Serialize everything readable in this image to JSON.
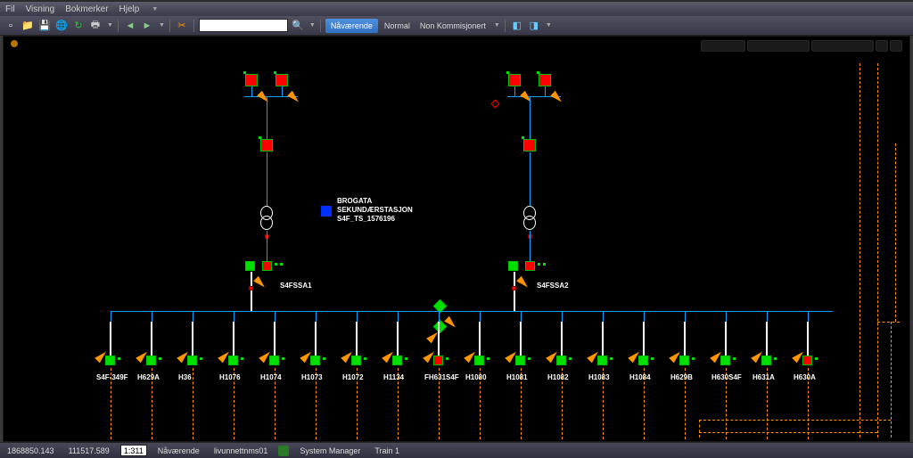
{
  "menu": {
    "items": [
      "Fil",
      "Visning",
      "Bokmerker",
      "Hjelp"
    ]
  },
  "toolbar": {
    "view_current": "Nåværende",
    "view_normal": "Normal",
    "view_noncomm": "Non Kommisjonert"
  },
  "station": {
    "name_line1": "BROGATA",
    "name_line2": "SEKUNDÆRSTASJON",
    "id": "S4F_TS_1576196"
  },
  "labels": {
    "bus1": "S4FSSA1",
    "bus2": "S4FSSA2"
  },
  "feeders": [
    "S4F-349F",
    "H629A",
    "H36",
    "H1076",
    "H1074",
    "H1073",
    "H1072",
    "H1134",
    "FH631S4F",
    "H1080",
    "H1081",
    "H1082",
    "H1083",
    "H1084",
    "H629B",
    "H630S4F",
    "H631A",
    "H630A"
  ],
  "status": {
    "coord_x": "1868850.143",
    "coord_y": "111517.589",
    "scale": "1:311",
    "view": "Nåværende",
    "server": "livunnettnms01",
    "sysmgr": "System Manager",
    "train": "Train 1"
  }
}
